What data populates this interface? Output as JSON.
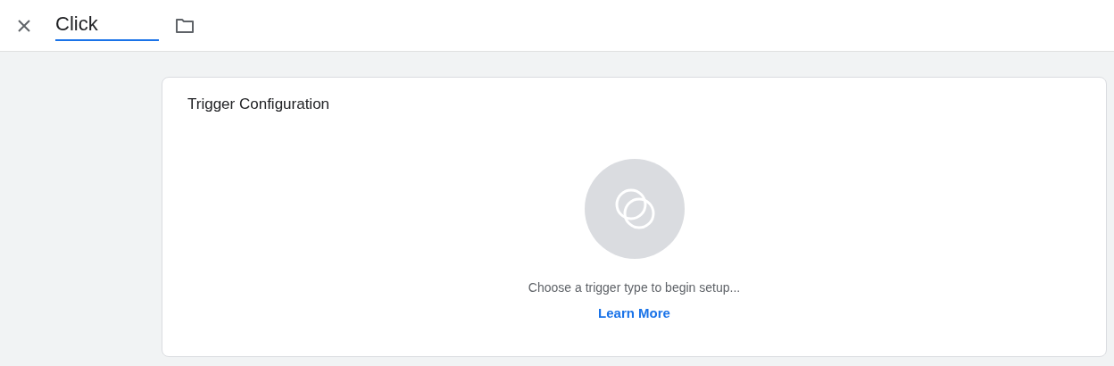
{
  "header": {
    "name_field": {
      "value": "Click"
    }
  },
  "card": {
    "title": "Trigger Configuration",
    "message": "Choose a trigger type to begin setup...",
    "link": "Learn More"
  }
}
